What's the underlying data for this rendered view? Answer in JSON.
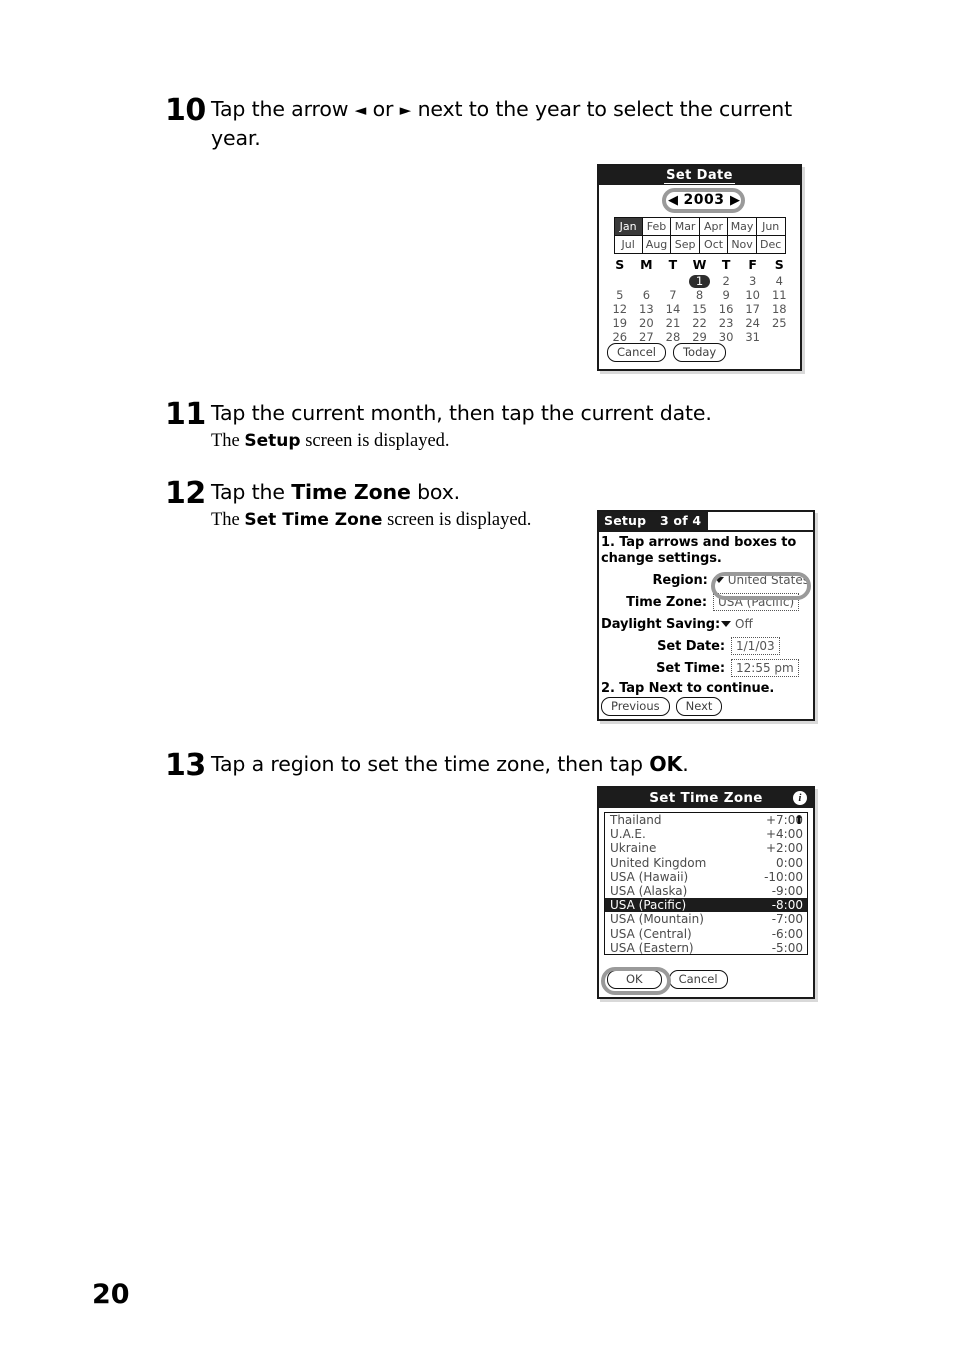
{
  "page": {
    "number": "20"
  },
  "steps": [
    {
      "number": "10",
      "main_pre": "Tap the arrow ",
      "main_arrow_left": "◄",
      "main_mid": " or ",
      "main_arrow_right": "►",
      "main_post": " next to the year to select the current year."
    },
    {
      "number": "11",
      "main": "Tap the current month, then tap the current date.",
      "sub_pre": "The ",
      "sub_bold": "Setup",
      "sub_post": " screen is displayed."
    },
    {
      "number": "12",
      "main_pre": "Tap the ",
      "main_bold": "Time Zone",
      "main_post": " box.",
      "sub_pre": "The ",
      "sub_bold": "Set Time Zone",
      "sub_post": " screen is displayed."
    },
    {
      "number": "13",
      "main_pre": "Tap a region to set the time zone, then tap ",
      "main_bold": "OK",
      "main_post": "."
    }
  ],
  "set_date_screen": {
    "title": "Set Date",
    "year": "2003",
    "prev_arrow": "◀",
    "next_arrow": "▶",
    "months": [
      "Jan",
      "Feb",
      "Mar",
      "Apr",
      "May",
      "Jun",
      "Jul",
      "Aug",
      "Sep",
      "Oct",
      "Nov",
      "Dec"
    ],
    "selected_month": "Jan",
    "day_headers": [
      "S",
      "M",
      "T",
      "W",
      "T",
      "F",
      "S"
    ],
    "weeks": [
      [
        "",
        "",
        "",
        "1",
        "2",
        "3",
        "4"
      ],
      [
        "5",
        "6",
        "7",
        "8",
        "9",
        "10",
        "11"
      ],
      [
        "12",
        "13",
        "14",
        "15",
        "16",
        "17",
        "18"
      ],
      [
        "19",
        "20",
        "21",
        "22",
        "23",
        "24",
        "25"
      ],
      [
        "26",
        "27",
        "28",
        "29",
        "30",
        "31",
        ""
      ]
    ],
    "selected_day": "1",
    "cancel_label": "Cancel",
    "today_label": "Today"
  },
  "setup_screen": {
    "tab_title": "Setup",
    "tab_step": "3 of 4",
    "instruction_1a": "1. Tap arrows and boxes to",
    "instruction_1b": "change settings.",
    "region_label": "Region:",
    "region_value": "United States",
    "timezone_label": "Time Zone:",
    "timezone_value": "USA (Pacific)",
    "daylight_label": "Daylight Saving:",
    "daylight_value": "Off",
    "set_date_label": "Set Date:",
    "set_date_value": "1/1/03",
    "set_time_label": "Set Time:",
    "set_time_value": "12:55 pm",
    "instruction_2": "2. Tap Next to continue.",
    "previous_label": "Previous",
    "next_label": "Next"
  },
  "set_time_zone_screen": {
    "title": "Set Time Zone",
    "info_icon": "i",
    "scroll_up_icon": "⬆",
    "zones": [
      {
        "name": "Thailand",
        "offset": "+7:00",
        "selected": false
      },
      {
        "name": "U.A.E.",
        "offset": "+4:00",
        "selected": false
      },
      {
        "name": "Ukraine",
        "offset": "+2:00",
        "selected": false
      },
      {
        "name": "United Kingdom",
        "offset": "0:00",
        "selected": false
      },
      {
        "name": "USA (Hawaii)",
        "offset": "-10:00",
        "selected": false
      },
      {
        "name": "USA (Alaska)",
        "offset": "-9:00",
        "selected": false
      },
      {
        "name": "USA (Pacific)",
        "offset": "-8:00",
        "selected": true
      },
      {
        "name": "USA (Mountain)",
        "offset": "-7:00",
        "selected": false
      },
      {
        "name": "USA (Central)",
        "offset": "-6:00",
        "selected": false
      },
      {
        "name": "USA (Eastern)",
        "offset": "-5:00",
        "selected": false
      }
    ],
    "ok_label": "OK",
    "cancel_label": "Cancel"
  },
  "colors": {
    "ink": "#000000",
    "screen_dark": "#1c1c1c",
    "highlight_gray": "#9a9a9a",
    "paper": "#ffffff"
  }
}
